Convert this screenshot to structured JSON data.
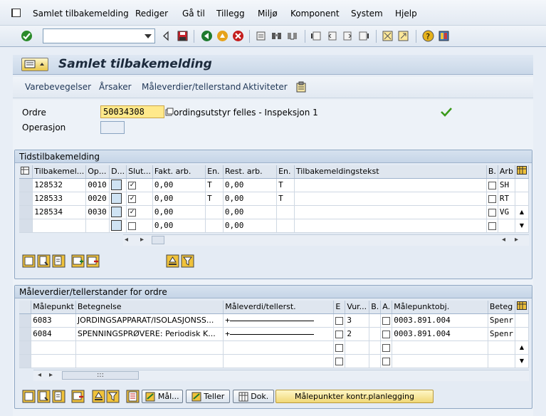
{
  "menu": {
    "items": [
      "Samlet tilbakemelding",
      "Rediger",
      "Gå til",
      "Tillegg",
      "Miljø",
      "Komponent",
      "System",
      "Hjelp"
    ]
  },
  "toolbar": {
    "command_value": ""
  },
  "title": "Samlet tilbakemelding",
  "app_toolbar": [
    "Varebevegelser",
    "Årsaker",
    "Måleverdier/tellerstand",
    "Aktiviteter"
  ],
  "header": {
    "ordre_label": "Ordre",
    "ordre_value": "50034308",
    "ordre_text": "ordingsutstyr felles - Inspeksjon 1",
    "operasjon_label": "Operasjon",
    "operasjon_value": ""
  },
  "time_group": {
    "title": "Tidstilbakemelding",
    "columns": [
      "Tilbakemel...",
      "Op...",
      "D...",
      "Slut...",
      "Fakt. arb.",
      "En.",
      "Rest. arb.",
      "En.",
      "Tilbakemeldingstekst",
      "B.",
      "Arb"
    ],
    "rows": [
      {
        "tilbakemel": "128532",
        "op": "0010",
        "slut": "✓",
        "fakt": "0,00",
        "en1": "T",
        "rest": "0,00",
        "en2": "T",
        "arb": "SH"
      },
      {
        "tilbakemel": "128533",
        "op": "0020",
        "slut": "✓",
        "fakt": "0,00",
        "en1": "T",
        "rest": "0,00",
        "en2": "T",
        "arb": "RT"
      },
      {
        "tilbakemel": "128534",
        "op": "0030",
        "slut": "✓",
        "fakt": "0,00",
        "en1": "",
        "rest": "0,00",
        "en2": "",
        "arb": "VG"
      },
      {
        "tilbakemel": "",
        "op": "",
        "slut": "",
        "fakt": "0,00",
        "en1": "",
        "rest": "0,00",
        "en2": "",
        "arb": ""
      }
    ]
  },
  "measure_group": {
    "title": "Måleverdier/tellerstander for ordre",
    "columns": [
      "Målepunkt",
      "Betegnelse",
      "Måleverdi/tellerst.",
      "E",
      "Vur...",
      "B.",
      "A.",
      "Målepunktobj.",
      "Beteg"
    ],
    "rows": [
      {
        "punkt": "6083",
        "beteg": "JORDINGSAPPARAT/ISOLASJONSS...",
        "verdi": "+",
        "vur": "3",
        "obj": "0003.891.004",
        "bet2": "Spenr"
      },
      {
        "punkt": "6084",
        "beteg": "SPENNINGSPRØVERE: Periodisk K...",
        "verdi": "+",
        "vur": "2",
        "obj": "0003.891.004",
        "bet2": "Spenr"
      },
      {
        "punkt": "",
        "beteg": "",
        "verdi": "",
        "vur": "",
        "obj": "",
        "bet2": ""
      },
      {
        "punkt": "",
        "beteg": "",
        "verdi": "",
        "vur": "",
        "obj": "",
        "bet2": ""
      }
    ],
    "buttons": {
      "mal": "Mål...",
      "teller": "Teller",
      "dok": "Dok.",
      "planlegging": "Målepunkter kontr.planlegging"
    }
  },
  "scroll_grip": ":::"
}
